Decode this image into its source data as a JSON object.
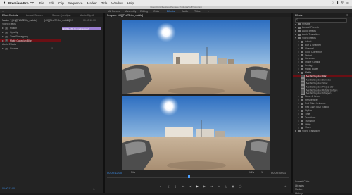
{
  "menubar": {
    "app_name": "Premiere Pro CC",
    "items": [
      "File",
      "Edit",
      "Clip",
      "Sequence",
      "Marker",
      "Title",
      "Window",
      "Help"
    ],
    "apple": ""
  },
  "path_title": "/Users/chris/Desktop/Premiere Pro/ExtraStuff/Vid.prproj",
  "workspaces": [
    "All Panels",
    "Assembly",
    "Editing",
    "Color",
    "Effects",
    "Audio",
    "Titles"
  ],
  "workspace_active": "Effects",
  "left_tabs": [
    "Effect Controls",
    "Lumetri Scopes",
    "Source: (no clips)",
    "Audio Clip M"
  ],
  "effect_controls": {
    "master": "Master * [4K]/[PLATE-fin_mobile]",
    "sequence": "[4K]/[PLATE-fin_mobile]",
    "clip_label": "[4K]/[PLATE-fin_mobile.mov]",
    "time_top": "00:00",
    "time_mid": "00:00:12:00",
    "sections": [
      "Video Effects",
      "Motion",
      "Opacity",
      "Time Remapping",
      "Matte Gaussian Blur",
      "Audio Effects",
      "Volume"
    ],
    "bottom_time": "00:00:12:00"
  },
  "program": {
    "tab": "Program: [4K]/[PLATE-fin_mobile]",
    "timecode": "00:00:12:00",
    "fit": "Fit",
    "quality": "1/2",
    "duration": "00:00:28:01"
  },
  "effects_panel": {
    "title": "Effects",
    "items": [
      {
        "label": "Presets",
        "type": "folder",
        "indent": 0,
        "open": false
      },
      {
        "label": "Lumetri Presets",
        "type": "folder",
        "indent": 0,
        "open": false
      },
      {
        "label": "Audio Effects",
        "type": "folder",
        "indent": 0,
        "open": false
      },
      {
        "label": "Audio Transitions",
        "type": "folder",
        "indent": 0,
        "open": false
      },
      {
        "label": "Video Effects",
        "type": "folder",
        "indent": 0,
        "open": true
      },
      {
        "label": "Adjust",
        "type": "folder",
        "indent": 1,
        "open": false
      },
      {
        "label": "Blur & Sharpen",
        "type": "folder",
        "indent": 1,
        "open": false
      },
      {
        "label": "Channel",
        "type": "folder",
        "indent": 1,
        "open": false
      },
      {
        "label": "Color Correction",
        "type": "folder",
        "indent": 1,
        "open": false
      },
      {
        "label": "Distort",
        "type": "folder",
        "indent": 1,
        "open": false
      },
      {
        "label": "Generate",
        "type": "folder",
        "indent": 1,
        "open": false
      },
      {
        "label": "Image Control",
        "type": "folder",
        "indent": 1,
        "open": false
      },
      {
        "label": "Keying",
        "type": "folder",
        "indent": 1,
        "open": false
      },
      {
        "label": "Magic Bullet",
        "type": "folder",
        "indent": 1,
        "open": false
      },
      {
        "label": "Mettle",
        "type": "folder",
        "indent": 1,
        "open": true
      },
      {
        "label": "Mettle SkyBox Blur",
        "type": "effect",
        "indent": 2,
        "selected": true
      },
      {
        "label": "Mettle SkyBox Denoise",
        "type": "effect",
        "indent": 2
      },
      {
        "label": "Mettle SkyBox Glow",
        "type": "effect",
        "indent": 2
      },
      {
        "label": "Mettle SkyBox Project 2D",
        "type": "effect",
        "indent": 2
      },
      {
        "label": "Mettle SkyBox Rotate Sphere",
        "type": "effect",
        "indent": 2
      },
      {
        "label": "Mettle SkyBox Sharpen",
        "type": "effect",
        "indent": 2
      },
      {
        "label": "Noise & Grain",
        "type": "folder",
        "indent": 1,
        "open": false
      },
      {
        "label": "Perspective",
        "type": "folder",
        "indent": 1,
        "open": false
      },
      {
        "label": "Red Giant Universe",
        "type": "folder",
        "indent": 1,
        "open": false
      },
      {
        "label": "Red Giant ILUT Studio",
        "type": "folder",
        "indent": 1,
        "open": false
      },
      {
        "label": "Stylize",
        "type": "folder",
        "indent": 1,
        "open": false
      },
      {
        "label": "Time",
        "type": "folder",
        "indent": 1,
        "open": false
      },
      {
        "label": "Transform",
        "type": "folder",
        "indent": 1,
        "open": false
      },
      {
        "label": "Transition",
        "type": "folder",
        "indent": 1,
        "open": false
      },
      {
        "label": "Utility",
        "type": "folder",
        "indent": 1,
        "open": false
      },
      {
        "label": "Video",
        "type": "folder",
        "indent": 1,
        "open": false
      },
      {
        "label": "Video Transitions",
        "type": "folder",
        "indent": 0,
        "open": false
      }
    ],
    "bottom_panels": [
      "Lumetri Color",
      "Libraries",
      "Markers",
      "History"
    ]
  },
  "colors": {
    "accent": "#4a9eff",
    "selection": "#6b0f14",
    "clip": "#9c7fd1"
  }
}
